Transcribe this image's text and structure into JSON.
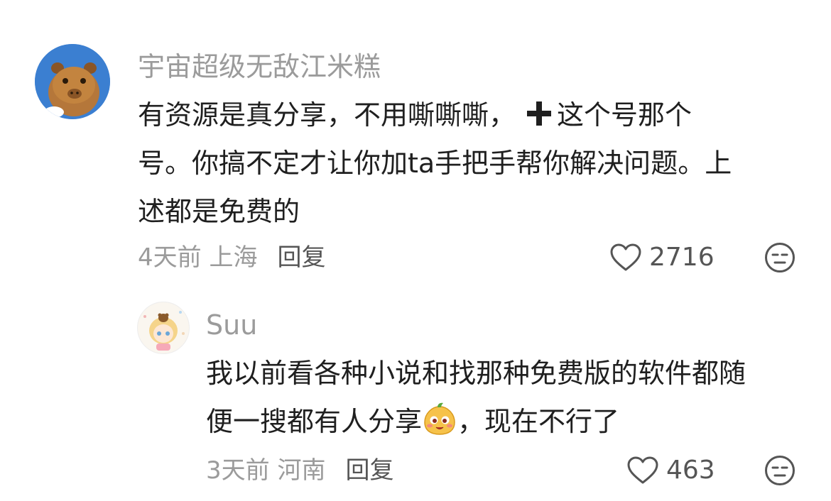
{
  "comments": [
    {
      "username": "宇宙超级无敌江米糕",
      "avatar_icon": "capybara-avatar",
      "text_lines": [
        "有资源是真分享，不用嘶嘶嘶，",
        "号。你搞不定才让你加ta手把手帮你解决问题。上",
        "述都是免费的"
      ],
      "text_line1_tail": "这个号那个",
      "inline_icon": "plus-icon",
      "time_location": "4天前 上海",
      "reply_label": "回复",
      "like_count": "2716"
    },
    {
      "username": "Suu",
      "avatar_icon": "anime-girl-avatar",
      "text_lines": [
        "我以前看各种小说和找那种免费版的软件都随",
        "便一搜都有人分享",
        "，现在不行了"
      ],
      "inline_icon": "smiling-bun-emoji",
      "time_location": "3天前 河南",
      "reply_label": "回复",
      "like_count": "463"
    }
  ],
  "colors": {
    "secondary_text": "#9b9b9b",
    "primary_text": "#1f1f1f",
    "avatar_blue": "#3b7fd1"
  }
}
